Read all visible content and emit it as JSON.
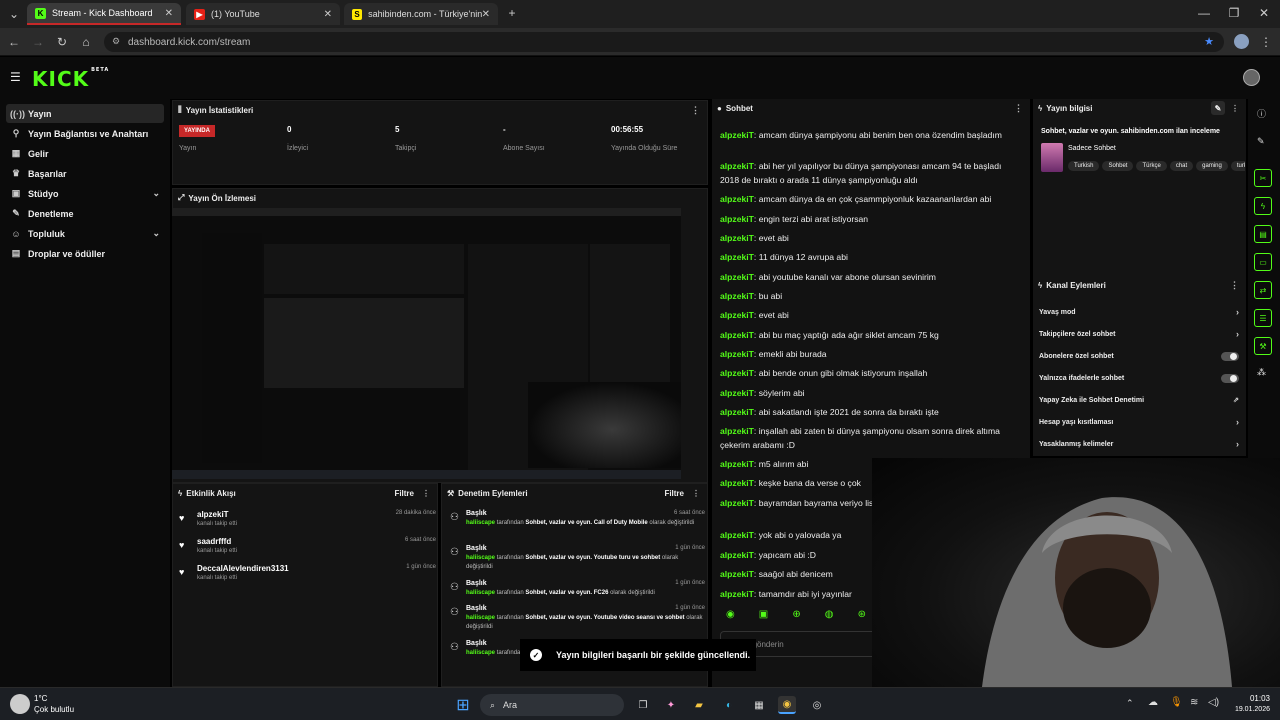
{
  "browser": {
    "tabs": [
      {
        "label": "Stream - Kick Dashboard",
        "active": true
      },
      {
        "label": "(1) YouTube",
        "active": false
      },
      {
        "label": "sahibinden.com - Türkiye'nin O",
        "active": false
      }
    ],
    "url": "dashboard.kick.com/stream"
  },
  "kick": {
    "logo": "KICK",
    "badge": "BETA"
  },
  "sidebar": {
    "items": [
      {
        "label": "Yayın",
        "icon": "broadcast-icon"
      },
      {
        "label": "Yayın Bağlantısı ve Anahtarı",
        "icon": "link-icon"
      },
      {
        "label": "Gelir",
        "icon": "money-icon"
      },
      {
        "label": "Başarılar",
        "icon": "trophy-icon"
      },
      {
        "label": "Stüdyo",
        "icon": "studio-icon"
      },
      {
        "label": "Denetleme",
        "icon": "wrench-icon"
      },
      {
        "label": "Topluluk",
        "icon": "community-icon"
      },
      {
        "label": "Droplar ve ödüller",
        "icon": "gift-icon"
      }
    ]
  },
  "stats": {
    "title": "Yayın İstatistikleri",
    "items": [
      {
        "value": "YAYINDA",
        "label": "Yayın"
      },
      {
        "value": "0",
        "label": "İzleyici"
      },
      {
        "value": "5",
        "label": "Takipçi"
      },
      {
        "value": "-",
        "label": "Abone Sayısı"
      },
      {
        "value": "00:56:55",
        "label": "Yayında Olduğu Süre"
      }
    ]
  },
  "preview": {
    "title": "Yayın Ön İzlemesi"
  },
  "activity": {
    "title": "Etkinlik Akışı",
    "filter": "Filtre",
    "items": [
      {
        "name": "alpzekiT",
        "desc": "kanalı takip etti",
        "time": "28 dakika önce"
      },
      {
        "name": "saadrfffd",
        "desc": "kanalı takip etti",
        "time": "6 saat önce"
      },
      {
        "name": "DeccalAlevlendiren3131",
        "desc": "kanalı takip etti",
        "time": "1 gün önce"
      }
    ]
  },
  "moderation": {
    "title": "Denetim Eylemleri",
    "filter": "Filtre",
    "items": [
      {
        "title": "Başlık",
        "time": "6 saat önce",
        "user": "haliiscape",
        "pre": "tarafından",
        "value": "Sohbet, vazlar ve oyun. Call of Duty Mobile",
        "post": "olarak değiştirildi"
      },
      {
        "title": "Başlık",
        "time": "1 gün önce",
        "user": "haliiscape",
        "pre": "tarafından",
        "value": "Sohbet, vazlar ve oyun. Youtube turu ve sohbet",
        "post": "olarak değiştirildi"
      },
      {
        "title": "Başlık",
        "time": "1 gün önce",
        "user": "haliiscape",
        "pre": "tarafından",
        "value": "Sohbet, vazlar ve oyun. FC26",
        "post": "olarak değiştirildi"
      },
      {
        "title": "Başlık",
        "time": "1 gün önce",
        "user": "haliiscape",
        "pre": "tarafından",
        "value": "Sohbet, vazlar ve oyun. Youtube video seansı ve sohbet",
        "post": "olarak değiştirildi"
      },
      {
        "title": "Başlık",
        "time": "1 gün önce",
        "user": "haliiscape",
        "pre": "tarafından",
        "value": "",
        "post": "değiştirildi"
      }
    ]
  },
  "chat": {
    "title": "Sohbet",
    "input_placeholder": "mesaj gönderin",
    "messages": [
      {
        "user": "alpzekiT",
        "text": "amcam dünya şampiyonu abi benim ben ona özendim başladım"
      },
      {
        "user": "alpzekiT",
        "text": "abi her yıl yapılıyor bu dünya şampiyonası amcam 94 te başladı 2018 de bıraktı o arada 11 dünya şampiyonluğu aldı"
      },
      {
        "user": "alpzekiT",
        "text": "amcam dünya da en çok çsammpiyonluk kazaananlardan abi"
      },
      {
        "user": "alpzekiT",
        "text": "engin terzi abi arat istiyorsan"
      },
      {
        "user": "alpzekiT",
        "text": "evet abi"
      },
      {
        "user": "alpzekiT",
        "text": "11 dünya 12 avrupa abi"
      },
      {
        "user": "alpzekiT",
        "text": "abi youtube kanalı var abone olursan sevinirim"
      },
      {
        "user": "alpzekiT",
        "text": "bu abi"
      },
      {
        "user": "alpzekiT",
        "text": "evet abi"
      },
      {
        "user": "alpzekiT",
        "text": "abi bu maç yaptığı ada ağır siklet amcam 75 kg"
      },
      {
        "user": "alpzekiT",
        "text": "emekli abi burada"
      },
      {
        "user": "alpzekiT",
        "text": "abi bende onun gibi olmak istiyorum inşallah"
      },
      {
        "user": "alpzekiT",
        "text": "söylerim abi"
      },
      {
        "user": "alpzekiT",
        "text": "abi sakatlandı işte 2021 de sonra da bıraktı işte"
      },
      {
        "user": "alpzekiT",
        "text": "inşallah abi zaten bi dünya şampiyonu olsam sonra direk altıma çekerim arabamı :D"
      },
      {
        "user": "alpzekiT",
        "text": "m5 alırım abi"
      },
      {
        "user": "alpzekiT",
        "text": "keşke bana da verse o çok"
      },
      {
        "user": "alpzekiT",
        "text": "bayramdan bayrama veriyo liseye gidiyor falan filan"
      },
      {
        "user": "alpzekiT",
        "text": "yok abi o yalovada ya"
      },
      {
        "user": "alpzekiT",
        "text": "yapıcam abi :D"
      },
      {
        "user": "alpzekiT",
        "text": "saağol abi denicem"
      },
      {
        "user": "alpzekiT",
        "text": "tamamdır abi iyi yayınlar"
      }
    ]
  },
  "info": {
    "title": "Yayın bilgisi",
    "stream_title": "Sohbet, vazlar ve oyun. sahibinden.com ilan inceleme",
    "category": "Sadece Sohbet",
    "tags": [
      "Turkish",
      "Sohbet",
      "Türkçe",
      "chat",
      "gaming",
      "turk"
    ]
  },
  "channel": {
    "title": "Kanal Eylemleri",
    "rows": [
      {
        "label": "Yavaş mod",
        "control": "arrow"
      },
      {
        "label": "Takipçilere özel sohbet",
        "control": "arrow"
      },
      {
        "label": "Abonelere özel sohbet",
        "control": "toggle"
      },
      {
        "label": "Yalnızca ifadelerle sohbet",
        "control": "toggle"
      },
      {
        "label": "Yapay Zeka ile Sohbet Denetimi",
        "control": "external"
      },
      {
        "label": "Hesap yaşı kısıtlaması",
        "control": "arrow"
      },
      {
        "label": "Yasaklanmış kelimeler",
        "control": "arrow"
      }
    ]
  },
  "toast": {
    "text": "Yayın bilgileri başarılı bir şekilde güncellendi."
  },
  "taskbar": {
    "weather_temp": "1°C",
    "weather_desc": "Çok bulutlu",
    "search": "Ara",
    "time": "01:03",
    "date": "19.01.2026"
  },
  "colors": {
    "accent": "#53fc18",
    "live": "#c62828",
    "panel": "#141414"
  }
}
